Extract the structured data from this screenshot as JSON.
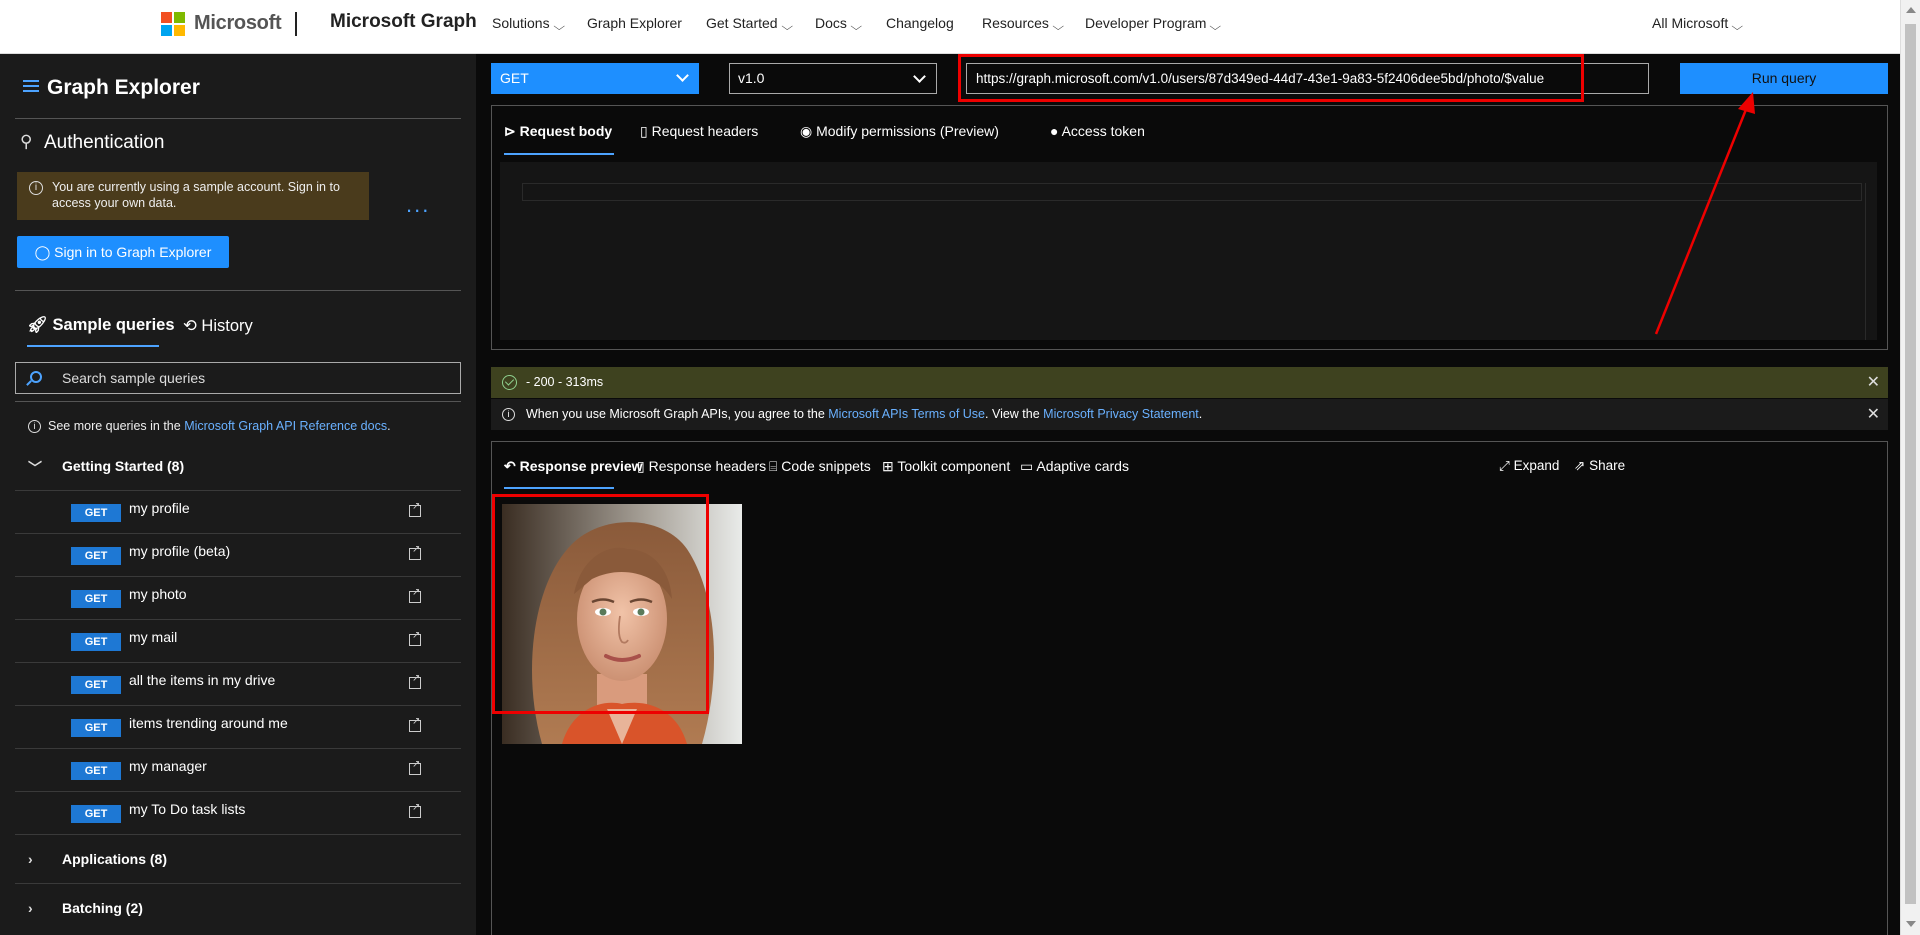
{
  "topnav": {
    "brand_word": "Microsoft",
    "product": "Microsoft Graph",
    "links": [
      "Solutions",
      "Graph Explorer",
      "Get Started",
      "Docs",
      "Changelog",
      "Resources",
      "Developer Program"
    ],
    "right_link": "All Microsoft"
  },
  "sidebar": {
    "title": "Graph Explorer",
    "auth_title": "Authentication",
    "notice": "You are currently using a sample account. Sign in to access your own data.",
    "more_dots": "...",
    "signin_label": "Sign in to Graph Explorer",
    "tabs": [
      "Sample queries",
      "History"
    ],
    "search_placeholder": "Search sample queries",
    "more_queries_prefix": "See more queries in the ",
    "more_queries_link": "Microsoft Graph API Reference docs",
    "more_queries_suffix": ".",
    "groups": [
      {
        "label": "Getting Started (8)",
        "expanded": true
      },
      {
        "label": "Applications (8)",
        "expanded": false
      },
      {
        "label": "Batching (2)",
        "expanded": false
      }
    ],
    "queries": [
      {
        "method": "GET",
        "label": "my profile"
      },
      {
        "method": "GET",
        "label": "my profile (beta)"
      },
      {
        "method": "GET",
        "label": "my photo"
      },
      {
        "method": "GET",
        "label": "my mail"
      },
      {
        "method": "GET",
        "label": "all the items in my drive"
      },
      {
        "method": "GET",
        "label": "items trending around me"
      },
      {
        "method": "GET",
        "label": "my manager"
      },
      {
        "method": "GET",
        "label": "my To Do task lists"
      }
    ]
  },
  "query_bar": {
    "method": "GET",
    "version": "v1.0",
    "url": "https://graph.microsoft.com/v1.0/users/87d349ed-44d7-43e1-9a83-5f2406dee5bd/photo/$value",
    "run_label": "Run query"
  },
  "request_tabs": [
    "Request body",
    "Request headers",
    "Modify permissions (Preview)",
    "Access token"
  ],
  "status": "- 200 - 313ms",
  "terms": {
    "prefix": "When you use Microsoft Graph APIs, you agree to the ",
    "link1": "Microsoft APIs Terms of Use",
    "middle": ". View the ",
    "link2": "Microsoft Privacy Statement",
    "suffix": "."
  },
  "response_tabs": [
    "Response preview",
    "Response headers",
    "Code snippets",
    "Toolkit component",
    "Adaptive cards"
  ],
  "response_actions": [
    "Expand",
    "Share"
  ],
  "colors": {
    "accent": "#1e8fff",
    "highlight": "#e00000",
    "status_bg": "#3e421f"
  }
}
